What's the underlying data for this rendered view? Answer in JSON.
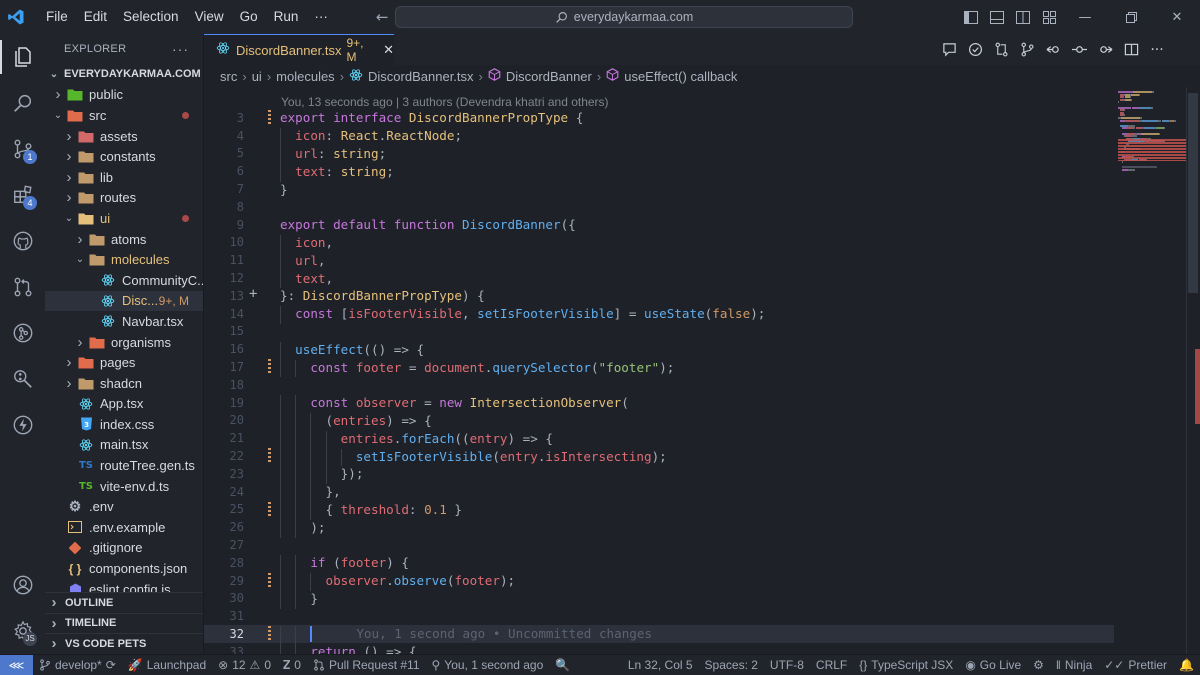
{
  "menu": [
    "File",
    "Edit",
    "Selection",
    "View",
    "Go",
    "Run",
    "···"
  ],
  "search": {
    "text": "everydaykarmaa.com"
  },
  "activity": {
    "scm_badge": "1",
    "extensions_badge": "4",
    "accounts_badge": "JS"
  },
  "sidebar": {
    "title": "EXPLORER",
    "root": "EVERYDAYKARMAA.COM",
    "items": [
      {
        "label": "public",
        "depth": 1,
        "type": "folder",
        "open": false,
        "icon": "folder-public-icon",
        "color": "#56b62c"
      },
      {
        "label": "src",
        "depth": 1,
        "type": "folder",
        "open": true,
        "icon": "folder-src-icon",
        "color": "#e06c4b",
        "mod": true
      },
      {
        "label": "assets",
        "depth": 2,
        "type": "folder",
        "open": false,
        "icon": "folder-assets-icon",
        "color": "#d16969"
      },
      {
        "label": "constants",
        "depth": 2,
        "type": "folder",
        "open": false,
        "icon": "folder-icon",
        "color": "#c19a6b"
      },
      {
        "label": "lib",
        "depth": 2,
        "type": "folder",
        "open": false,
        "icon": "folder-lib-icon",
        "color": "#c19a6b"
      },
      {
        "label": "routes",
        "depth": 2,
        "type": "folder",
        "open": false,
        "icon": "folder-routes-icon",
        "color": "#c19a6b"
      },
      {
        "label": "ui",
        "depth": 2,
        "type": "folder",
        "open": true,
        "icon": "folder-ui-icon",
        "color": "#e5c07b",
        "mod": true,
        "labelColor": "#e5c07b"
      },
      {
        "label": "atoms",
        "depth": 3,
        "type": "folder",
        "open": false,
        "icon": "folder-icon",
        "color": "#c19a6b"
      },
      {
        "label": "molecules",
        "depth": 3,
        "type": "folder",
        "open": true,
        "icon": "folder-icon",
        "color": "#c19a6b",
        "labelColor": "#e5c07b"
      },
      {
        "label": "CommunityC...",
        "depth": 4,
        "type": "react",
        "icon": "react-icon",
        "color": "#61dafb"
      },
      {
        "label": "Disc...",
        "depth": 4,
        "type": "react",
        "icon": "react-icon",
        "color": "#61dafb",
        "selected": true,
        "labelColor": "#e5c07b",
        "status": "9+, M"
      },
      {
        "label": "Navbar.tsx",
        "depth": 4,
        "type": "react",
        "icon": "react-icon",
        "color": "#61dafb"
      },
      {
        "label": "organisms",
        "depth": 3,
        "type": "folder",
        "open": false,
        "icon": "folder-icon",
        "color": "#e06c4b"
      },
      {
        "label": "pages",
        "depth": 2,
        "type": "folder",
        "open": false,
        "icon": "folder-icon",
        "color": "#e06c4b"
      },
      {
        "label": "shadcn",
        "depth": 2,
        "type": "folder",
        "open": false,
        "icon": "folder-icon",
        "color": "#c19a6b"
      },
      {
        "label": "App.tsx",
        "depth": 2,
        "type": "react",
        "icon": "react-icon",
        "color": "#61dafb"
      },
      {
        "label": "index.css",
        "depth": 2,
        "type": "css",
        "icon": "css-icon",
        "color": "#42a5f5"
      },
      {
        "label": "main.tsx",
        "depth": 2,
        "type": "react",
        "icon": "react-icon",
        "color": "#61dafb"
      },
      {
        "label": "routeTree.gen.ts",
        "depth": 2,
        "type": "ts",
        "icon": "typescript-icon",
        "color": "#3178c6"
      },
      {
        "label": "vite-env.d.ts",
        "depth": 2,
        "type": "ts",
        "icon": "typescript-icon",
        "color": "#56b62c"
      },
      {
        "label": ".env",
        "depth": 1,
        "type": "gear",
        "icon": "gear-icon",
        "color": "#abb2bf"
      },
      {
        "label": ".env.example",
        "depth": 1,
        "type": "term",
        "icon": "terminal-icon",
        "color": "#e5c07b"
      },
      {
        "label": ".gitignore",
        "depth": 1,
        "type": "git",
        "icon": "git-icon",
        "color": "#e06c4b"
      },
      {
        "label": "components.json",
        "depth": 1,
        "type": "json",
        "icon": "json-icon",
        "color": "#e5c07b"
      },
      {
        "label": "eslint.config.js",
        "depth": 1,
        "type": "eslint",
        "icon": "eslint-icon",
        "color": "#8080f2"
      }
    ],
    "sections": [
      "OUTLINE",
      "TIMELINE",
      "VS CODE PETS"
    ]
  },
  "tab": {
    "name": "DiscordBanner.tsx",
    "status": "9+, M"
  },
  "breadcrumb": [
    "src",
    "ui",
    "molecules",
    "DiscordBanner.tsx",
    "DiscordBanner",
    "useEffect() callback"
  ],
  "blame_top": "You, 13 seconds ago | 3 authors (Devendra khatri and others)",
  "code": [
    {
      "n": "3",
      "mark": true,
      "t": [
        [
          "kw",
          "export "
        ],
        [
          "kw",
          "interface "
        ],
        [
          "ty",
          "DiscordBannerPropType"
        ],
        [
          "pn",
          " {"
        ]
      ]
    },
    {
      "n": "4",
      "indent": 1,
      "t": [
        [
          "pr",
          "icon"
        ],
        [
          "pn",
          ": "
        ],
        [
          "ty",
          "React"
        ],
        [
          "pn",
          "."
        ],
        [
          "ty",
          "ReactNode"
        ],
        [
          "pn",
          ";"
        ]
      ]
    },
    {
      "n": "5",
      "indent": 1,
      "t": [
        [
          "pr",
          "url"
        ],
        [
          "pn",
          ": "
        ],
        [
          "ty",
          "string"
        ],
        [
          "pn",
          ";"
        ]
      ]
    },
    {
      "n": "6",
      "indent": 1,
      "t": [
        [
          "pr",
          "text"
        ],
        [
          "pn",
          ": "
        ],
        [
          "ty",
          "string"
        ],
        [
          "pn",
          ";"
        ]
      ]
    },
    {
      "n": "7",
      "t": [
        [
          "pn",
          "}"
        ]
      ]
    },
    {
      "n": "8",
      "t": []
    },
    {
      "n": "9",
      "t": [
        [
          "kw",
          "export "
        ],
        [
          "kw",
          "default "
        ],
        [
          "kw",
          "function "
        ],
        [
          "fn",
          "DiscordBanner"
        ],
        [
          "pn",
          "({"
        ]
      ]
    },
    {
      "n": "10",
      "indent": 1,
      "t": [
        [
          "pr",
          "icon"
        ],
        [
          "pn",
          ","
        ]
      ]
    },
    {
      "n": "11",
      "indent": 1,
      "t": [
        [
          "pr",
          "url"
        ],
        [
          "pn",
          ","
        ]
      ]
    },
    {
      "n": "12",
      "indent": 1,
      "t": [
        [
          "pr",
          "text"
        ],
        [
          "pn",
          ","
        ]
      ]
    },
    {
      "n": "13",
      "plus": true,
      "t": [
        [
          "pn",
          "}: "
        ],
        [
          "ty",
          "DiscordBannerPropType"
        ],
        [
          "pn",
          ") {"
        ]
      ]
    },
    {
      "n": "14",
      "indent": 1,
      "t": [
        [
          "kw",
          "const "
        ],
        [
          "pn",
          "["
        ],
        [
          "pr",
          "isFooterVisible"
        ],
        [
          "pn",
          ", "
        ],
        [
          "fn",
          "setIsFooterVisible"
        ],
        [
          "pn",
          "] = "
        ],
        [
          "fn",
          "useState"
        ],
        [
          "pn",
          "("
        ],
        [
          "nu",
          "false"
        ],
        [
          "pn",
          ");"
        ]
      ]
    },
    {
      "n": "15",
      "t": []
    },
    {
      "n": "16",
      "indent": 1,
      "t": [
        [
          "fn",
          "useEffect"
        ],
        [
          "pn",
          "(() => {"
        ]
      ]
    },
    {
      "n": "17",
      "indent": 2,
      "mark": true,
      "t": [
        [
          "kw",
          "const "
        ],
        [
          "pr",
          "footer"
        ],
        [
          "pn",
          " = "
        ],
        [
          "pr",
          "document"
        ],
        [
          "pn",
          "."
        ],
        [
          "fn",
          "querySelector"
        ],
        [
          "pn",
          "("
        ],
        [
          "st",
          "\"footer\""
        ],
        [
          "pn",
          ");"
        ]
      ]
    },
    {
      "n": "18",
      "t": []
    },
    {
      "n": "19",
      "indent": 2,
      "t": [
        [
          "kw",
          "const "
        ],
        [
          "pr",
          "observer"
        ],
        [
          "pn",
          " = "
        ],
        [
          "kw",
          "new "
        ],
        [
          "ty",
          "IntersectionObserver"
        ],
        [
          "pn",
          "("
        ]
      ]
    },
    {
      "n": "20",
      "indent": 3,
      "t": [
        [
          "pn",
          "("
        ],
        [
          "pr",
          "entries"
        ],
        [
          "pn",
          ") => {"
        ]
      ]
    },
    {
      "n": "21",
      "indent": 4,
      "t": [
        [
          "pr",
          "entries"
        ],
        [
          "pn",
          "."
        ],
        [
          "fn",
          "forEach"
        ],
        [
          "pn",
          "(("
        ],
        [
          "pr",
          "entry"
        ],
        [
          "pn",
          ") => {"
        ]
      ]
    },
    {
      "n": "22",
      "indent": 5,
      "mark": true,
      "t": [
        [
          "fn",
          "setIsFooterVisible"
        ],
        [
          "pn",
          "("
        ],
        [
          "pr",
          "entry"
        ],
        [
          "pn",
          "."
        ],
        [
          "pr",
          "isIntersecting"
        ],
        [
          "pn",
          ");"
        ]
      ]
    },
    {
      "n": "23",
      "indent": 4,
      "t": [
        [
          "pn",
          "});"
        ]
      ]
    },
    {
      "n": "24",
      "indent": 3,
      "t": [
        [
          "pn",
          "},"
        ]
      ]
    },
    {
      "n": "25",
      "indent": 3,
      "mark": true,
      "t": [
        [
          "pn",
          "{ "
        ],
        [
          "pr",
          "threshold"
        ],
        [
          "pn",
          ": "
        ],
        [
          "nu",
          "0.1"
        ],
        [
          "pn",
          " }"
        ]
      ]
    },
    {
      "n": "26",
      "indent": 2,
      "t": [
        [
          "pn",
          ");"
        ]
      ]
    },
    {
      "n": "27",
      "t": []
    },
    {
      "n": "28",
      "indent": 2,
      "t": [
        [
          "kw",
          "if "
        ],
        [
          "pn",
          "("
        ],
        [
          "pr",
          "footer"
        ],
        [
          "pn",
          ") {"
        ]
      ]
    },
    {
      "n": "29",
      "indent": 3,
      "mark": true,
      "t": [
        [
          "pr",
          "observer"
        ],
        [
          "pn",
          "."
        ],
        [
          "fn",
          "observe"
        ],
        [
          "pn",
          "("
        ],
        [
          "pr",
          "footer"
        ],
        [
          "pn",
          ");"
        ]
      ]
    },
    {
      "n": "30",
      "indent": 2,
      "t": [
        [
          "pn",
          "}"
        ]
      ]
    },
    {
      "n": "31",
      "t": []
    },
    {
      "n": "32",
      "indent": 2,
      "current": true,
      "mark": true,
      "t": [
        [
          "gh",
          "You, 1 second ago • Uncommitted changes"
        ]
      ]
    },
    {
      "n": "33",
      "indent": 2,
      "t": [
        [
          "kw",
          "return "
        ],
        [
          "pn",
          "() => {"
        ]
      ]
    }
  ],
  "status": {
    "branch": "develop*",
    "launchpad": "Launchpad",
    "errors": "12",
    "warnings": "0",
    "ports": "0",
    "pull_request": "Pull Request #11",
    "blame": "You, 1 second ago",
    "position": "Ln 32, Col 5",
    "spaces": "Spaces: 2",
    "encoding": "UTF-8",
    "eol": "CRLF",
    "language": "TypeScript JSX",
    "golive": "Go Live",
    "ninja": "Ninja",
    "prettier": "Prettier"
  },
  "colors": {
    "accent": "#528bff",
    "remote": "#4d78cc",
    "modified": "#e5c07b"
  }
}
